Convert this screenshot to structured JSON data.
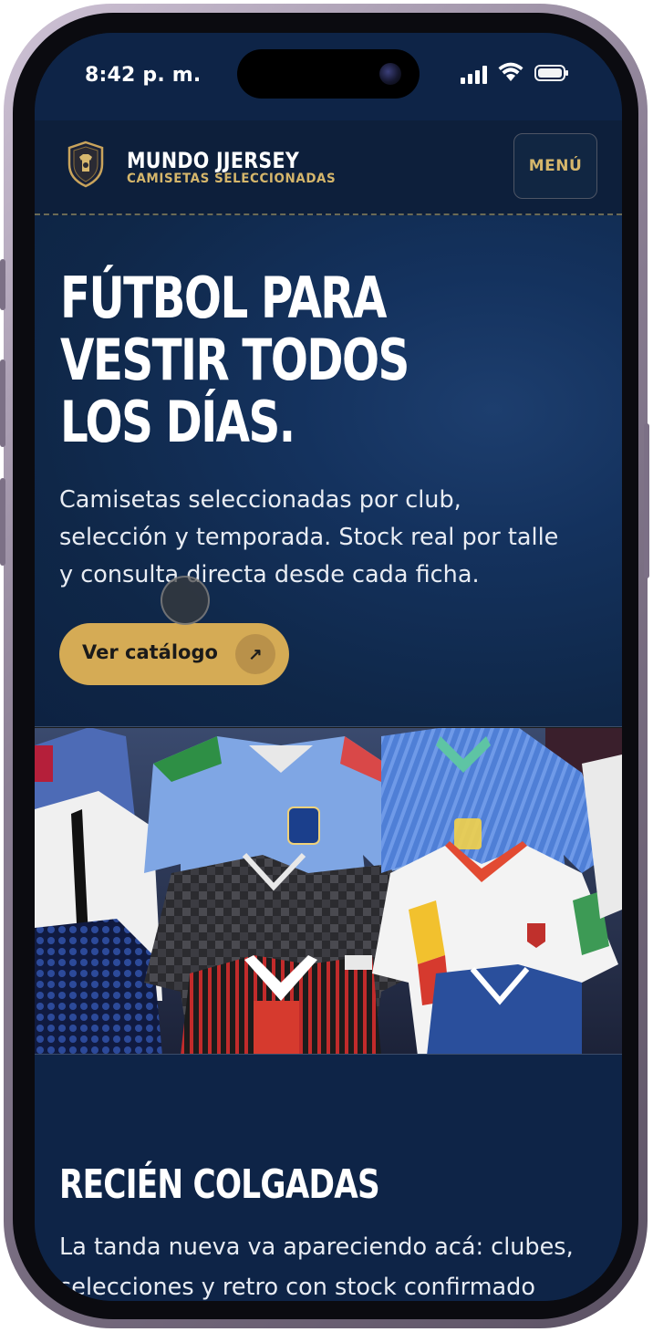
{
  "status_bar": {
    "time": "8:42 p. m."
  },
  "header": {
    "brand_name": "MUNDO JJERSEY",
    "brand_tagline": "CAMISETAS SELECCIONADAS",
    "logo_icon": "jersey-shield-icon",
    "menu_label": "MENÚ"
  },
  "hero": {
    "title_lines": [
      "FÚTBOL PARA",
      "VESTIR TODOS",
      "LOS DÍAS."
    ],
    "subtitle": "Camisetas seleccionadas por club, selección y temporada. Stock real por talle y consulta directa desde cada ficha.",
    "cta_label": "Ver catálogo",
    "cta_icon": "arrow-up-right-icon"
  },
  "section": {
    "title": "RECIÉN COLGADAS",
    "body_lines": [
      "La tanda nueva va apareciendo acá: clubes,",
      "selecciones y retro con stock confirmado"
    ]
  },
  "colors": {
    "background": "#0e2447",
    "accent_gold": "#d5ab55",
    "tagline_gold": "#d5b66b"
  }
}
